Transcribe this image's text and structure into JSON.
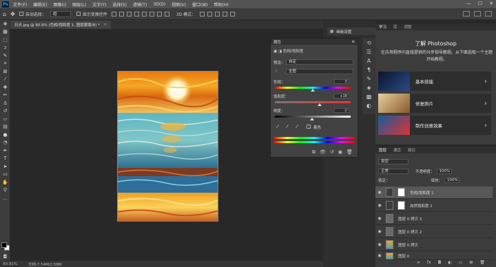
{
  "app": {
    "logo": "Ps"
  },
  "menubar": {
    "items": [
      "文件(F)",
      "编辑(E)",
      "图像(I)",
      "图层(L)",
      "文字(Y)",
      "选择(S)",
      "滤镜(T)",
      "3D(D)",
      "视图(V)",
      "窗口(W)",
      "帮助(H)"
    ],
    "window_controls": [
      "—",
      "☐",
      "✕"
    ]
  },
  "options": {
    "auto_select_label": "自动选择：",
    "auto_select_value": "组",
    "show_transform_label": "显示变换控件",
    "mode_3d": "3D 模式："
  },
  "document": {
    "tab_title": "日天.jpg @ 90.9% (色相/饱和度 1, 图层蒙版/8) *",
    "close": "×"
  },
  "status": {
    "zoom": "90.91%",
    "doc_size": "文档:7.54M/2.58M"
  },
  "properties": {
    "title": "属性",
    "adjust_title": "色相/饱和度",
    "preset_label": "预设：",
    "preset_value": "自定",
    "channel_value": "全图",
    "hue_label": "色相：",
    "hue_value": "0",
    "hue_pos": 0.5,
    "sat_label": "饱和度：",
    "sat_value": "+18",
    "sat_pos": 0.59,
    "light_label": "明度：",
    "light_value": "-2",
    "light_pos": 0.49,
    "colorize_label": "着色"
  },
  "panel_links": {
    "label": "画板设置"
  },
  "learn": {
    "tabs": [
      "学习",
      "库",
      "调整"
    ],
    "title": "了解 Photoshop",
    "description": "在应用程序内直接提供的分步指导教程。从下面选取一个主题开始教程。",
    "cards": [
      {
        "label": "基本技能",
        "thumb": "#1c2a4a"
      },
      {
        "label": "修复照片",
        "thumb": "#b9894d"
      },
      {
        "label": "制作创意效果",
        "thumb": "#c0392b"
      }
    ]
  },
  "layers": {
    "tabs": [
      "图层",
      "通道",
      "路径"
    ],
    "filter_label": "类型",
    "blend_mode": "正常",
    "opacity_label": "不透明度：",
    "opacity_value": "100%",
    "lock_label": "锁定：",
    "fill_label": "填充：",
    "fill_value": "100%",
    "items": [
      {
        "name": "色相/饱和度 1"
      },
      {
        "name": "自然饱和度 1"
      },
      {
        "name": "图层 0 拷贝 3"
      },
      {
        "name": "图层 0 拷贝 2"
      },
      {
        "name": "图层 0 拷贝"
      },
      {
        "name": "图层 0"
      }
    ]
  },
  "colors": {
    "accent": "#31a8ff",
    "panel_bg": "#3c3c3c",
    "app_bg": "#282828"
  }
}
